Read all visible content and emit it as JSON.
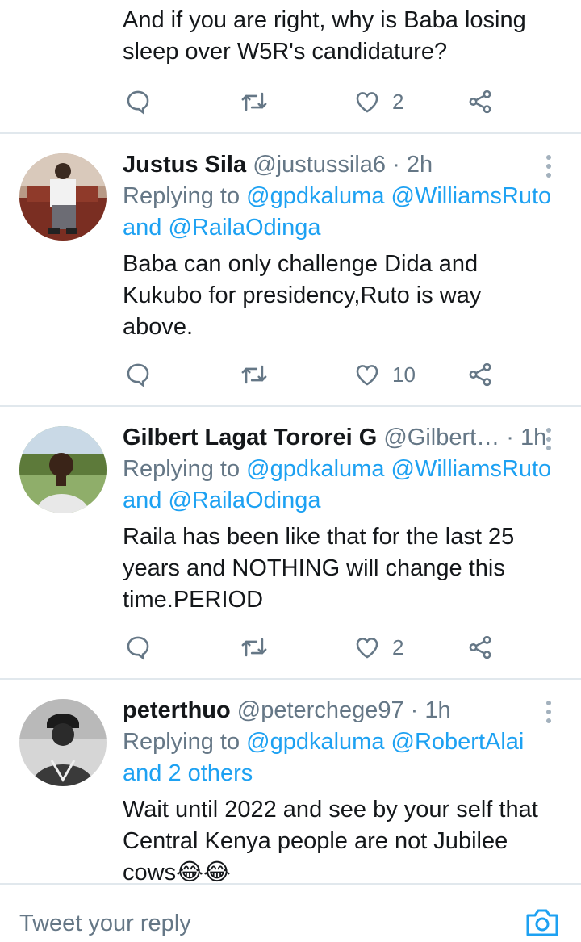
{
  "partial_tweet": {
    "text": "And if you are right, why is Baba losing sleep over W5R's candidature?",
    "likes": "2"
  },
  "tweets": [
    {
      "name": "Justus Sila",
      "handle": "@justussila6",
      "separator": "·",
      "time": "2h",
      "replying_prefix": "Replying to",
      "mentions": "@gpdkaluma @WilliamsRuto",
      "connector": "and",
      "mentions_2": "@RailaOdinga",
      "text": "Baba can only challenge Dida and Kukubo for presidency,Ruto is way above.",
      "likes": "10"
    },
    {
      "name": "Gilbert Lagat Tororei G",
      "handle": "@Gilbert…",
      "separator": "·",
      "time": "1h",
      "replying_prefix": "Replying to",
      "mentions": "@gpdkaluma @WilliamsRuto",
      "connector": "and",
      "mentions_2": "@RailaOdinga",
      "text": "Raila has been like that for the last 25 years and NOTHING will change this time.PERIOD",
      "likes": "2"
    },
    {
      "name": "peterthuo",
      "handle": "@peterchege97",
      "separator": "·",
      "time": "1h",
      "replying_prefix": "Replying to",
      "mentions": "@gpdkaluma @RobertAlai",
      "connector": "",
      "mentions_2": "and 2 others",
      "text": "Wait until 2022 and see by your self that Central Kenya people are not Jubilee cows😂😂"
    }
  ],
  "compose": {
    "placeholder": "Tweet your reply"
  },
  "icons": {
    "reply": "reply-icon",
    "retweet": "retweet-icon",
    "like": "heart-icon",
    "share": "share-icon",
    "more": "more-vertical-icon",
    "camera": "camera-icon"
  },
  "colors": {
    "accent": "#1da1f2",
    "secondary_text": "#657786",
    "primary_text": "#14171a",
    "divider": "#e1e8ed"
  }
}
